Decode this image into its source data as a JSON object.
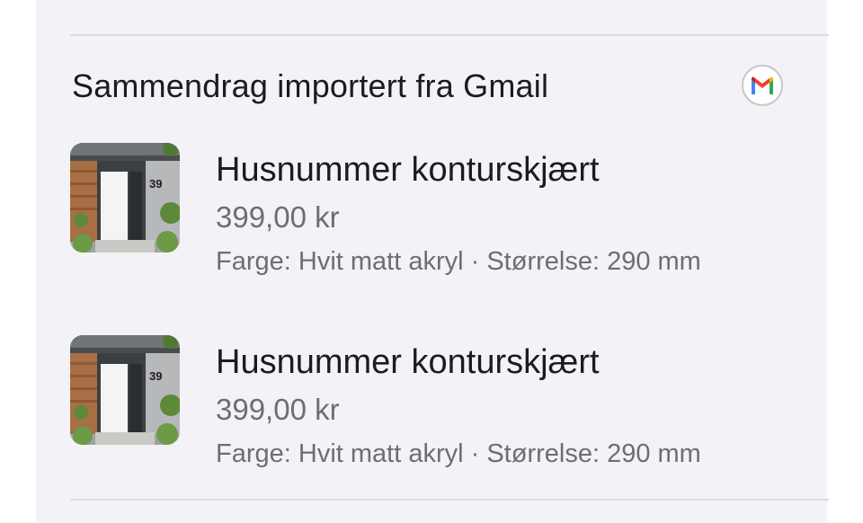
{
  "section": {
    "title": "Sammendrag importert fra Gmail",
    "source_icon": "gmail-icon"
  },
  "items": [
    {
      "name": "Husnummer konturskjært",
      "price": "399,00 kr",
      "details": "Farge: Hvit matt akryl · Størrelse: 290 mm",
      "thumbnail_icon": "house-door-photo",
      "thumbnail_number": "39"
    },
    {
      "name": "Husnummer konturskjært",
      "price": "399,00 kr",
      "details": "Farge: Hvit matt akryl · Størrelse: 290 mm",
      "thumbnail_icon": "house-door-photo",
      "thumbnail_number": "39"
    }
  ],
  "colors": {
    "background": "#f2f2f7",
    "primary_text": "#1c1c1e",
    "secondary_text": "#6d6d72",
    "gmail_red": "#ea4335",
    "gmail_blue": "#4285f4",
    "gmail_yellow": "#fbbc04",
    "gmail_green": "#34a853"
  }
}
